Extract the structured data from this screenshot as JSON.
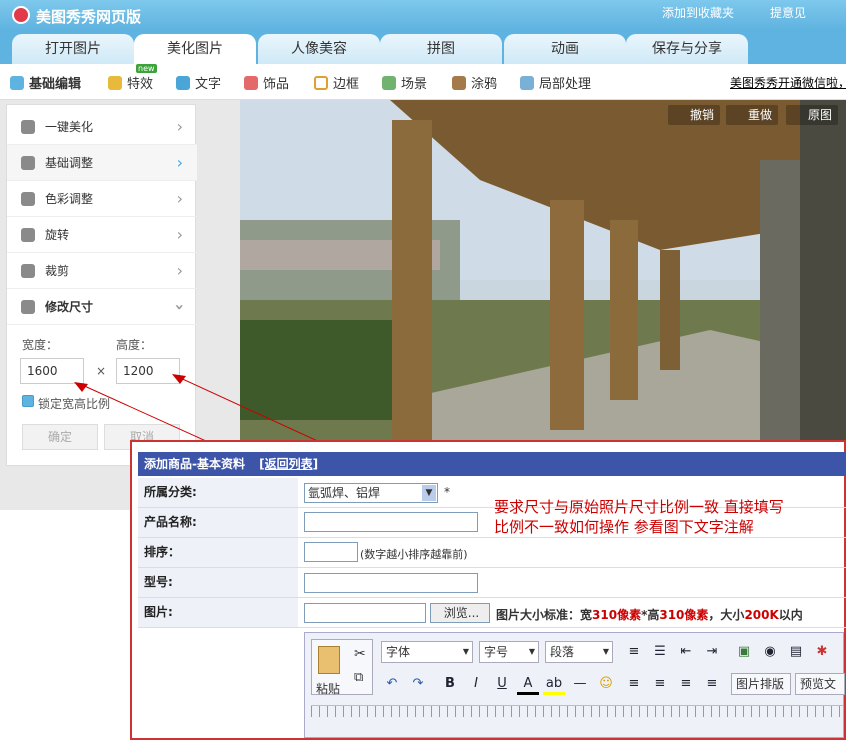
{
  "app": {
    "title": "美图秀秀网页版",
    "links": [
      "添加到收藏夹",
      "提意见"
    ]
  },
  "tabs": [
    "打开图片",
    "美化图片",
    "人像美容",
    "拼图",
    "动画",
    "保存与分享"
  ],
  "toolbar": {
    "items": [
      "基础编辑",
      "特效",
      "文字",
      "饰品",
      "边框",
      "场景",
      "涂鸦",
      "局部处理"
    ],
    "new_badge": "new",
    "promo": "美图秀秀开通微信啦，"
  },
  "history": {
    "undo": "撤销",
    "redo": "重做",
    "original": "原图"
  },
  "panel": {
    "items": [
      "一键美化",
      "基础调整",
      "色彩调整",
      "旋转",
      "裁剪",
      "修改尺寸"
    ],
    "width_label": "宽度：",
    "height_label": "高度：",
    "width_value": "1600",
    "height_value": "1200",
    "times": "×",
    "lock_label": "锁定宽高比例",
    "confirm": "确定",
    "cancel": "取消"
  },
  "form": {
    "header": "添加商品-基本资料",
    "back_link": "[返回列表]",
    "rows": [
      "所属分类:",
      "产品名称:",
      "排序：",
      "型号:",
      "图片:"
    ],
    "category": "氩弧焊、铝焊",
    "required_mark": "*",
    "sort_hint": "(数字越小排序越靠前)",
    "browse": "浏览...",
    "image_hint": {
      "prefix": "图片大小标准：宽",
      "w": "310像素",
      "mid": "*高",
      "h": "310像素",
      "tail": "，大小",
      "size": "200K",
      "end": "以内"
    },
    "note_line1": "要求尺寸与原始照片尺寸比例一致  直接填写",
    "note_line2": "比例不一致如何操作  参看图下文字注解"
  },
  "editor": {
    "paste": "粘贴",
    "font": "字体",
    "size": "字号",
    "para": "段落",
    "image_layout": "图片排版",
    "preview": "预览文"
  },
  "colors": {
    "accent": "#5fb3e0",
    "form_header": "#3d55a8",
    "annotation": "#cc0000"
  }
}
